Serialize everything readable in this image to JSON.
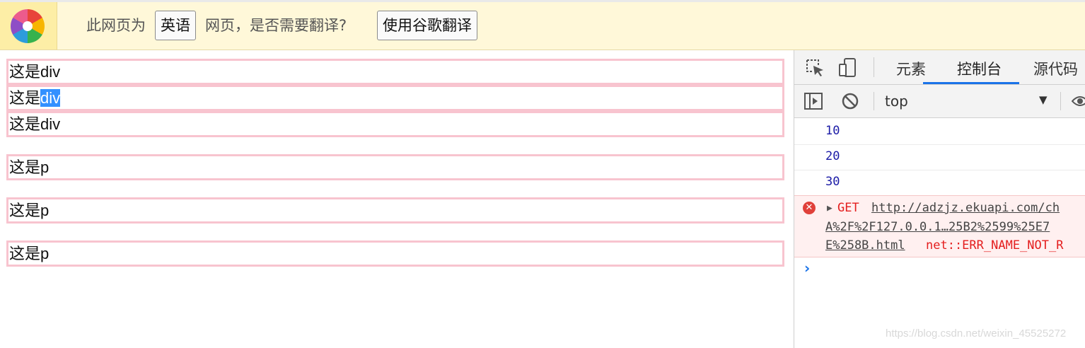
{
  "translate_bar": {
    "message_prefix": "此网页为",
    "language": "英语",
    "message_suffix": "网页，是否需要翻译?",
    "translate_button": "使用谷歌翻译"
  },
  "page": {
    "divs": [
      {
        "prefix": "这是",
        "suffix": "div"
      },
      {
        "prefix": "这是",
        "selected": "div"
      },
      {
        "prefix": "这是",
        "suffix": "div"
      }
    ],
    "paragraphs": [
      "这是p",
      "这是p",
      "这是p"
    ]
  },
  "devtools": {
    "tabs": [
      "元素",
      "控制台",
      "源代码"
    ],
    "active_tab": "控制台",
    "context": "top",
    "logs": [
      "10",
      "20",
      "30"
    ],
    "error": {
      "method": "GET",
      "url_line1": "http://adzjz.ekuapi.com/ch",
      "url_line2": "A%2F%2F127.0.0.1…25B2%2599%25E7",
      "url_line3": "E%258B.html",
      "message": "net::ERR_NAME_NOT_R"
    },
    "prompt": "›"
  },
  "watermark": "https://blog.csdn.net/weixin_45525272",
  "colors": {
    "box_border": "#f8c4cf",
    "selection": "#3390ff",
    "accent": "#1a73e8",
    "error": "#e41e1e"
  }
}
